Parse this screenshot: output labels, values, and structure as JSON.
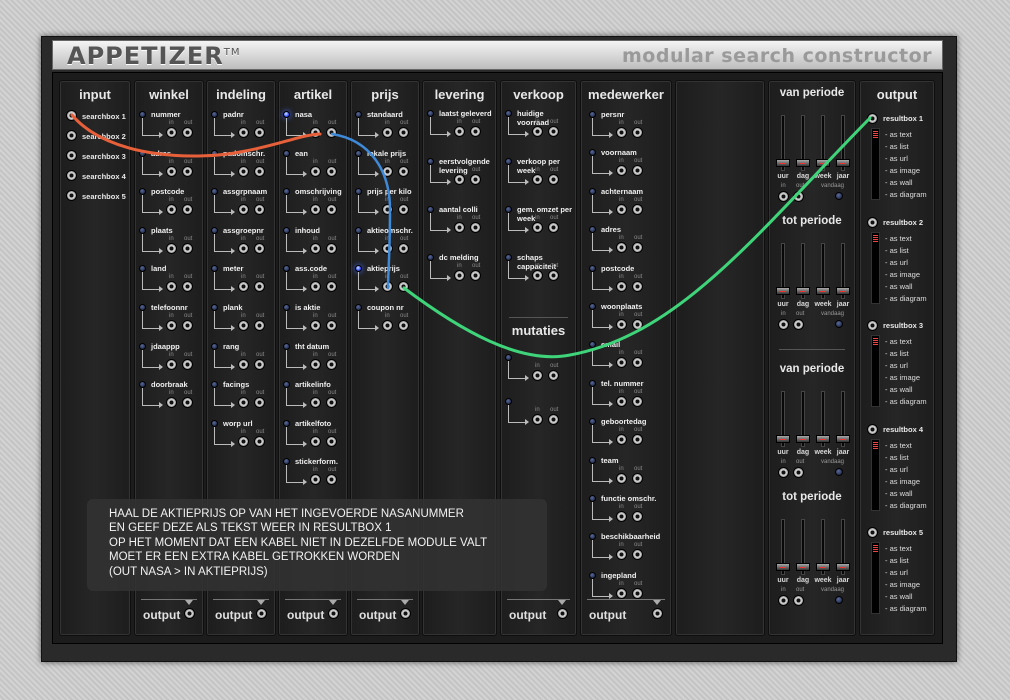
{
  "header": {
    "title": "APPETIZER",
    "tm": "TM",
    "subtitle": "modular search constructor"
  },
  "input": {
    "title": "input",
    "boxes": [
      "searchbox 1",
      "searchbox 2",
      "searchbox 3",
      "searchbox 4",
      "searchbox 5"
    ]
  },
  "io": {
    "in": "in",
    "out": "out"
  },
  "output_label": "output",
  "winkel": {
    "title": "winkel",
    "items": [
      "nummer",
      "adres",
      "postcode",
      "plaats",
      "land",
      "telefoonnr",
      "jdaappp",
      "doorbraak"
    ]
  },
  "indeling": {
    "title": "indeling",
    "items": [
      "padnr",
      "padomschr.",
      "assgrpnaam",
      "assgroepnr",
      "meter",
      "plank",
      "rang",
      "facings",
      "worp url"
    ]
  },
  "artikel": {
    "title": "artikel",
    "items": [
      "nasa",
      "ean",
      "omschrijving",
      "inhoud",
      "ass.code",
      "is aktie",
      "tht datum",
      "artikelinfo",
      "artikelfoto",
      "stickerform."
    ]
  },
  "prijs": {
    "title": "prijs",
    "items": [
      "standaard",
      "lokale prijs",
      "prijs per kilo",
      "aktieomschr.",
      "aktieprijs",
      "coupon nr"
    ]
  },
  "levering": {
    "title": "levering",
    "items": [
      "laatst geleverd",
      "eerstvolgende levering",
      "aantal colli",
      "dc melding"
    ]
  },
  "verkoop": {
    "title": "verkoop",
    "items": [
      "huidige voorraad",
      "verkoop per week",
      "gem. omzet per week",
      "schaps cappaciteit"
    ],
    "mutaties": "mutaties"
  },
  "medewerker": {
    "title": "medewerker",
    "items": [
      "persnr",
      "voornaam",
      "achternaam",
      "adres",
      "postcode",
      "woonplaats",
      "email",
      "tel. nummer",
      "geboortedag",
      "team",
      "functie omschr.",
      "beschikbaarheid",
      "ingepland"
    ]
  },
  "periods": {
    "groups": [
      "van periode",
      "tot periode",
      "van periode",
      "tot periode"
    ],
    "sliders": [
      "uur",
      "dag",
      "week",
      "jaar"
    ],
    "vandaag": "vandaag"
  },
  "output": {
    "title": "output",
    "boxes": [
      "resultbox 1",
      "resultbox 2",
      "resultbox 3",
      "resultbox 4",
      "resultbox 5"
    ],
    "types": [
      "- as text",
      "- as list",
      "- as url",
      "- as image",
      "- as wall",
      "- as diagram"
    ]
  },
  "note": {
    "lines": [
      "HAAL DE AKTIEPRIJS OP VAN HET INGEVOERDE NASANUMMER",
      "EN GEEF DEZE ALS TEKST WEER IN RESULTBOX 1",
      "OP HET MOMENT DAT EEN KABEL NIET IN DEZELFDE MODULE VALT",
      "MOET ER EEN EXTRA KABEL GETROKKEN WORDEN",
      "(OUT NASA > IN AKTIEPRIJS)"
    ]
  },
  "active_leds": [
    "artikel.nasa",
    "prijs.aktieprijs"
  ],
  "cable_colors": {
    "orange": "#e8603a",
    "blue": "#3f8ad8",
    "green": "#3fd47a"
  }
}
